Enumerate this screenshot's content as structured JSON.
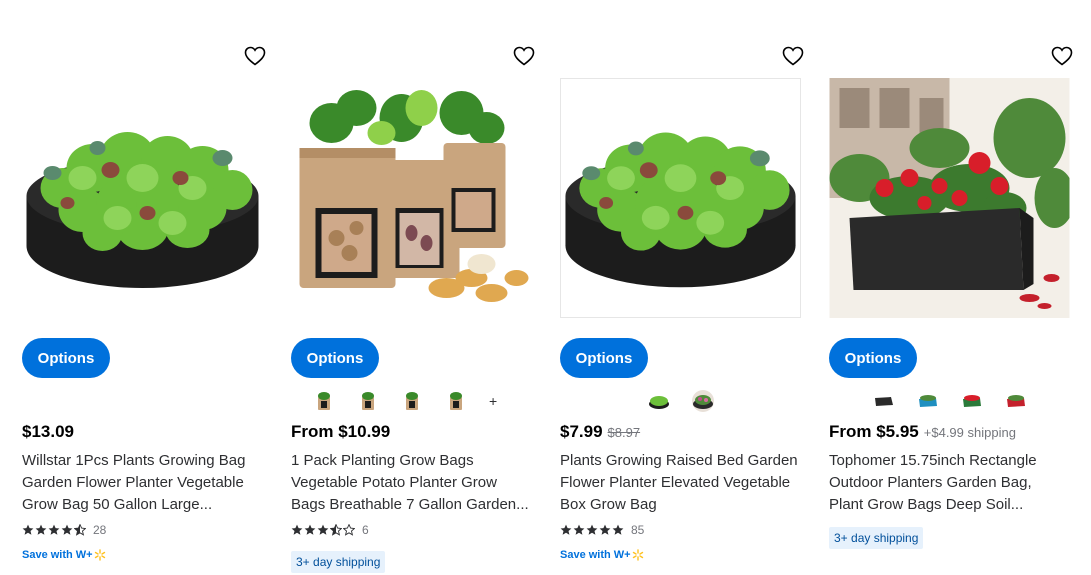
{
  "colors": {
    "brand_blue": "#0071dc",
    "price": "#000000",
    "muted": "#74767c",
    "badge_bg": "#e6f1fc",
    "badge_text": "#004f9a",
    "star": "#2e2f32"
  },
  "products": [
    {
      "image": "round-fabric-bed-with-lettuce",
      "options_label": "Options",
      "price": "$13.09",
      "title": "Willstar 1Pcs Plants Growing Bag Garden Flower Planter Vegetable Grow Bag 50 Gallon Large...",
      "rating": 4.5,
      "review_count": "28",
      "save_with": "Save with W+"
    },
    {
      "image": "potato-grow-bags-with-window",
      "options_label": "Options",
      "swatches": [
        "tan-bag",
        "tan-bag",
        "tan-bag",
        "tan-bag"
      ],
      "swatch_more": "+",
      "price": "From $10.99",
      "title": "1 Pack Planting Grow Bags Vegetable Potato Planter Grow Bags Breathable 7 Gallon Garden...",
      "rating": 3.5,
      "review_count": "6",
      "shipping_badge": "3+ day shipping"
    },
    {
      "image": "round-fabric-bed-with-lettuce",
      "options_label": "Options",
      "swatches": [
        "green-bed",
        "flower-bed"
      ],
      "price": "$7.99",
      "was_price": "$8.97",
      "title": "Plants Growing Raised Bed Garden Flower Planter Elevated Vegetable Box Grow Bag",
      "rating": 5,
      "review_count": "85",
      "save_with": "Save with W+"
    },
    {
      "image": "rectangle-bag-with-red-roses",
      "options_label": "Options",
      "swatches": [
        "black-rect",
        "blue-rect",
        "green-rect",
        "red-rect"
      ],
      "price": "From $5.95",
      "shipping": "+$4.99 shipping",
      "title": "Tophomer 15.75inch Rectangle Outdoor Planters Garden Bag, Plant Grow Bags Deep Soil...",
      "shipping_badge": "3+ day shipping"
    }
  ]
}
